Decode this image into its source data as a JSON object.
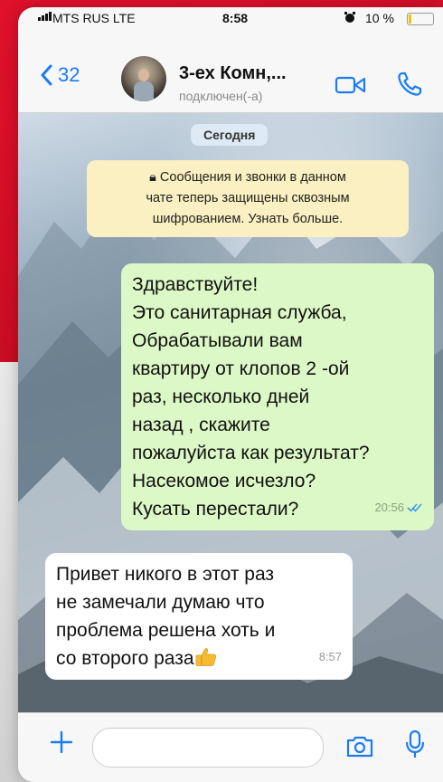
{
  "status_bar": {
    "carrier": "MTS RUS  LTE",
    "time": "8:58",
    "alarm_icon": "alarm-clock-icon",
    "battery": "10 %"
  },
  "header": {
    "back_count": "32",
    "chat_name": "3-ех Комн,...",
    "chat_status": "подключен(-а)"
  },
  "chat": {
    "date_chip": "Сегодня",
    "encryption_notice": {
      "lines": [
        "Сообщения и звонки в данном",
        "чате теперь защищены сквозным",
        "шифрованием. Узнать больше."
      ]
    },
    "messages": [
      {
        "direction": "outgoing",
        "lines": [
          "Здравствуйте!",
          "Это санитарная служба,",
          "Обрабатывали вам",
          "квартиру от клопов 2 -ой",
          "раз, несколько дней",
          "назад , скажите",
          "пожалуйста как результат?",
          "Насекомое исчезло?",
          "Кусать перестали?"
        ],
        "time": "20:56",
        "status": "read"
      },
      {
        "direction": "incoming",
        "lines": [
          "Привет никого в этот раз",
          "не замечали думаю что",
          "проблема решена хоть и",
          "со второго раза"
        ],
        "emoji": "thumbs-up-icon",
        "time": "8:57"
      }
    ]
  },
  "input_bar": {
    "placeholder": ""
  },
  "colors": {
    "accent": "#1a7cf5",
    "outgoing_bubble": "#dcf8c6",
    "incoming_bubble": "#ffffff",
    "notice_bubble": "#fbf0c1",
    "background_red": "#d7142b"
  }
}
